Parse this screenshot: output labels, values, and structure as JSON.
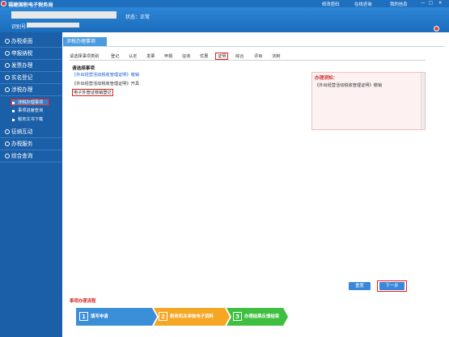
{
  "topbar": {
    "title": "福建国税电子税务局",
    "links": [
      "修改密码",
      "在线咨询",
      "我的信息"
    ]
  },
  "header": {
    "status": "状态：正常",
    "id_label": "识别号："
  },
  "sidebar": {
    "items": [
      "办税桌面",
      "申报纳税",
      "发票办理",
      "实名登记",
      "涉税办理",
      "征纳互动",
      "办税服务",
      "综合查询"
    ],
    "subitems": [
      "涉税办理事项",
      "事项进度查询",
      "税务文书下载"
    ]
  },
  "main": {
    "tab_title": "涉税办理事项",
    "category_tabs": [
      "请选择事项类别",
      "登记",
      "认定",
      "发票",
      "申报",
      "征收",
      "优惠",
      "证明",
      "综合",
      "评目",
      "法制"
    ],
    "select_heading": "请选择事项",
    "items": [
      "《外出经营活动税收管理证明》缴销",
      "《外出经营活动税收管理证明》开具",
      "电子外管证核销登记"
    ],
    "notice_title": "办理须知：",
    "notice_text": "《外出经营活动税收管理证明》缴销",
    "reset_button": "重置",
    "next_button": "下一步",
    "flow_title": "事项办理流程",
    "flow_steps": [
      {
        "num": "1",
        "label": "填写申请"
      },
      {
        "num": "2",
        "label": "税务机关审核电子资料"
      },
      {
        "num": "3",
        "label": "办理结果反馈结束"
      }
    ]
  },
  "colors": {
    "brand": "#1f6fbf",
    "sidebar": "#1a5fa8",
    "step1": "#3b8fd9",
    "step2": "#f5a623",
    "step3": "#3fbf3f",
    "highlight": "#e02020"
  }
}
